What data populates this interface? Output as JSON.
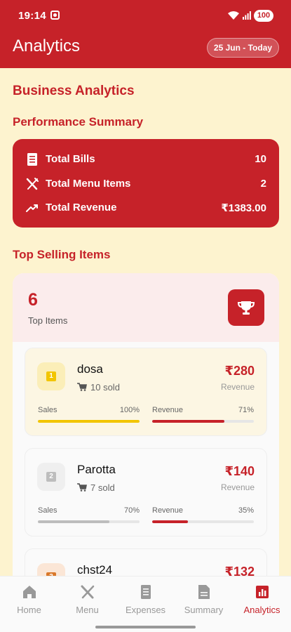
{
  "status": {
    "time": "19:14",
    "battery": "100"
  },
  "appbar": {
    "title": "Analytics",
    "date_range": "25 Jun - Today"
  },
  "page": {
    "title": "Business Analytics",
    "performance_heading": "Performance Summary",
    "top_selling_heading": "Top Selling Items"
  },
  "summary": [
    {
      "icon": "receipt-icon",
      "label": "Total Bills",
      "value": "10"
    },
    {
      "icon": "fork-knife-icon",
      "label": "Total Menu Items",
      "value": "2"
    },
    {
      "icon": "trend-up-icon",
      "label": "Total Revenue",
      "value": "₹1383.00"
    }
  ],
  "top_items": {
    "count": "6",
    "count_label": "Top Items",
    "icon": "trophy-icon",
    "items": [
      {
        "rank": "1",
        "name": "dosa",
        "sold": "10 sold",
        "price": "₹280",
        "revenue_label": "Revenue",
        "sales_label": "Sales",
        "sales_pct": "100%",
        "sales_value": 1.0,
        "rev_label": "Revenue",
        "rev_pct": "71%",
        "rev_value": 0.71,
        "color": "#f2c500"
      },
      {
        "rank": "2",
        "name": "Parotta",
        "sold": "7 sold",
        "price": "₹140",
        "revenue_label": "Revenue",
        "sales_label": "Sales",
        "sales_pct": "70%",
        "sales_value": 0.7,
        "rev_label": "Revenue",
        "rev_pct": "35%",
        "rev_value": 0.35,
        "color": "#bdbdbd"
      },
      {
        "rank": "3",
        "name": "chst24",
        "price": "₹132",
        "color": "#d9782a"
      }
    ]
  },
  "nav": [
    {
      "icon": "home-icon",
      "label": "Home",
      "active": false
    },
    {
      "icon": "menu-fork-knife-icon",
      "label": "Menu",
      "active": false
    },
    {
      "icon": "expenses-icon",
      "label": "Expenses",
      "active": false
    },
    {
      "icon": "summary-icon",
      "label": "Summary",
      "active": false
    },
    {
      "icon": "analytics-icon",
      "label": "Analytics",
      "active": true
    }
  ],
  "colors": {
    "primary": "#c62229",
    "background": "#fdf3cf",
    "gold": "#f2c500",
    "silver": "#bdbdbd",
    "bronze": "#d9782a"
  }
}
